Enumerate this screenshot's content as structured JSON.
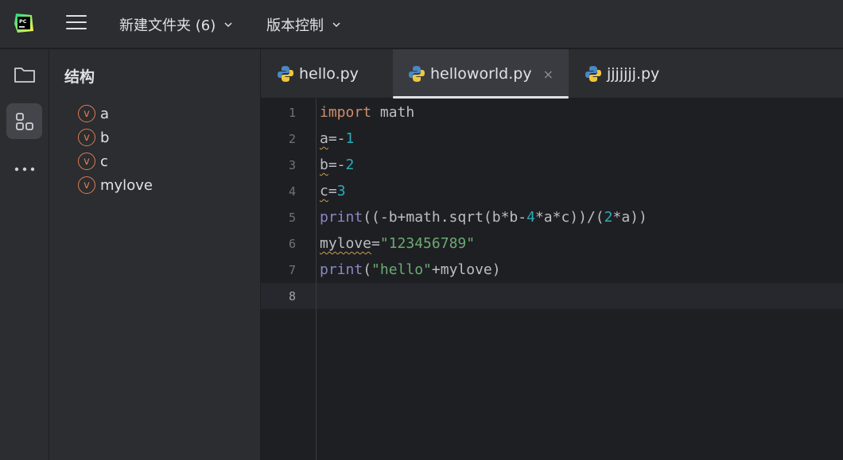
{
  "topbar": {
    "project_label": "新建文件夹 (6)",
    "vcs_label": "版本控制",
    "logo_text": "PC"
  },
  "toolstrip": {
    "items": [
      {
        "icon": "folder-icon"
      },
      {
        "icon": "structure-icon",
        "active": true
      },
      {
        "icon": "more-icon"
      }
    ]
  },
  "structure": {
    "title": "结构",
    "items": [
      {
        "badge": "v",
        "label": "a"
      },
      {
        "badge": "v",
        "label": "b"
      },
      {
        "badge": "v",
        "label": "c"
      },
      {
        "badge": "v",
        "label": "mylove"
      }
    ]
  },
  "tabs": [
    {
      "label": "hello.py",
      "icon": "python-icon"
    },
    {
      "label": "helloworld.py",
      "icon": "python-icon",
      "active": true,
      "close": "×"
    },
    {
      "label": "jjjjjjj.py",
      "icon": "python-icon"
    }
  ],
  "editor": {
    "line_numbers": [
      "1",
      "2",
      "3",
      "4",
      "5",
      "6",
      "7",
      "8"
    ],
    "current_line": "8",
    "lines": [
      [
        {
          "t": "import",
          "c": "kw"
        },
        {
          "t": " math",
          "c": ""
        }
      ],
      [
        {
          "t": "a",
          "c": "wavy"
        },
        {
          "t": "=-",
          "c": ""
        },
        {
          "t": "1",
          "c": "num"
        }
      ],
      [
        {
          "t": "b",
          "c": "wavy"
        },
        {
          "t": "=-",
          "c": ""
        },
        {
          "t": "2",
          "c": "num"
        }
      ],
      [
        {
          "t": "c",
          "c": "wavy"
        },
        {
          "t": "=",
          "c": ""
        },
        {
          "t": "3",
          "c": "num"
        }
      ],
      [
        {
          "t": "print",
          "c": "fn"
        },
        {
          "t": "((-b+math.sqrt(b*b-",
          "c": ""
        },
        {
          "t": "4",
          "c": "num"
        },
        {
          "t": "*a*c))/(",
          "c": ""
        },
        {
          "t": "2",
          "c": "num"
        },
        {
          "t": "*a))",
          "c": ""
        }
      ],
      [
        {
          "t": "mylove",
          "c": "wavy"
        },
        {
          "t": "=",
          "c": ""
        },
        {
          "t": "\"123456789\"",
          "c": "str"
        }
      ],
      [
        {
          "t": "print",
          "c": "fn"
        },
        {
          "t": "(",
          "c": ""
        },
        {
          "t": "\"hello\"",
          "c": "str"
        },
        {
          "t": "+mylove)",
          "c": ""
        }
      ],
      []
    ]
  },
  "colors": {
    "accent_badge": "#e07b53",
    "keyword": "#cf8e6d",
    "number": "#2aacb8",
    "string": "#6aab73",
    "builtin": "#8888c6"
  }
}
